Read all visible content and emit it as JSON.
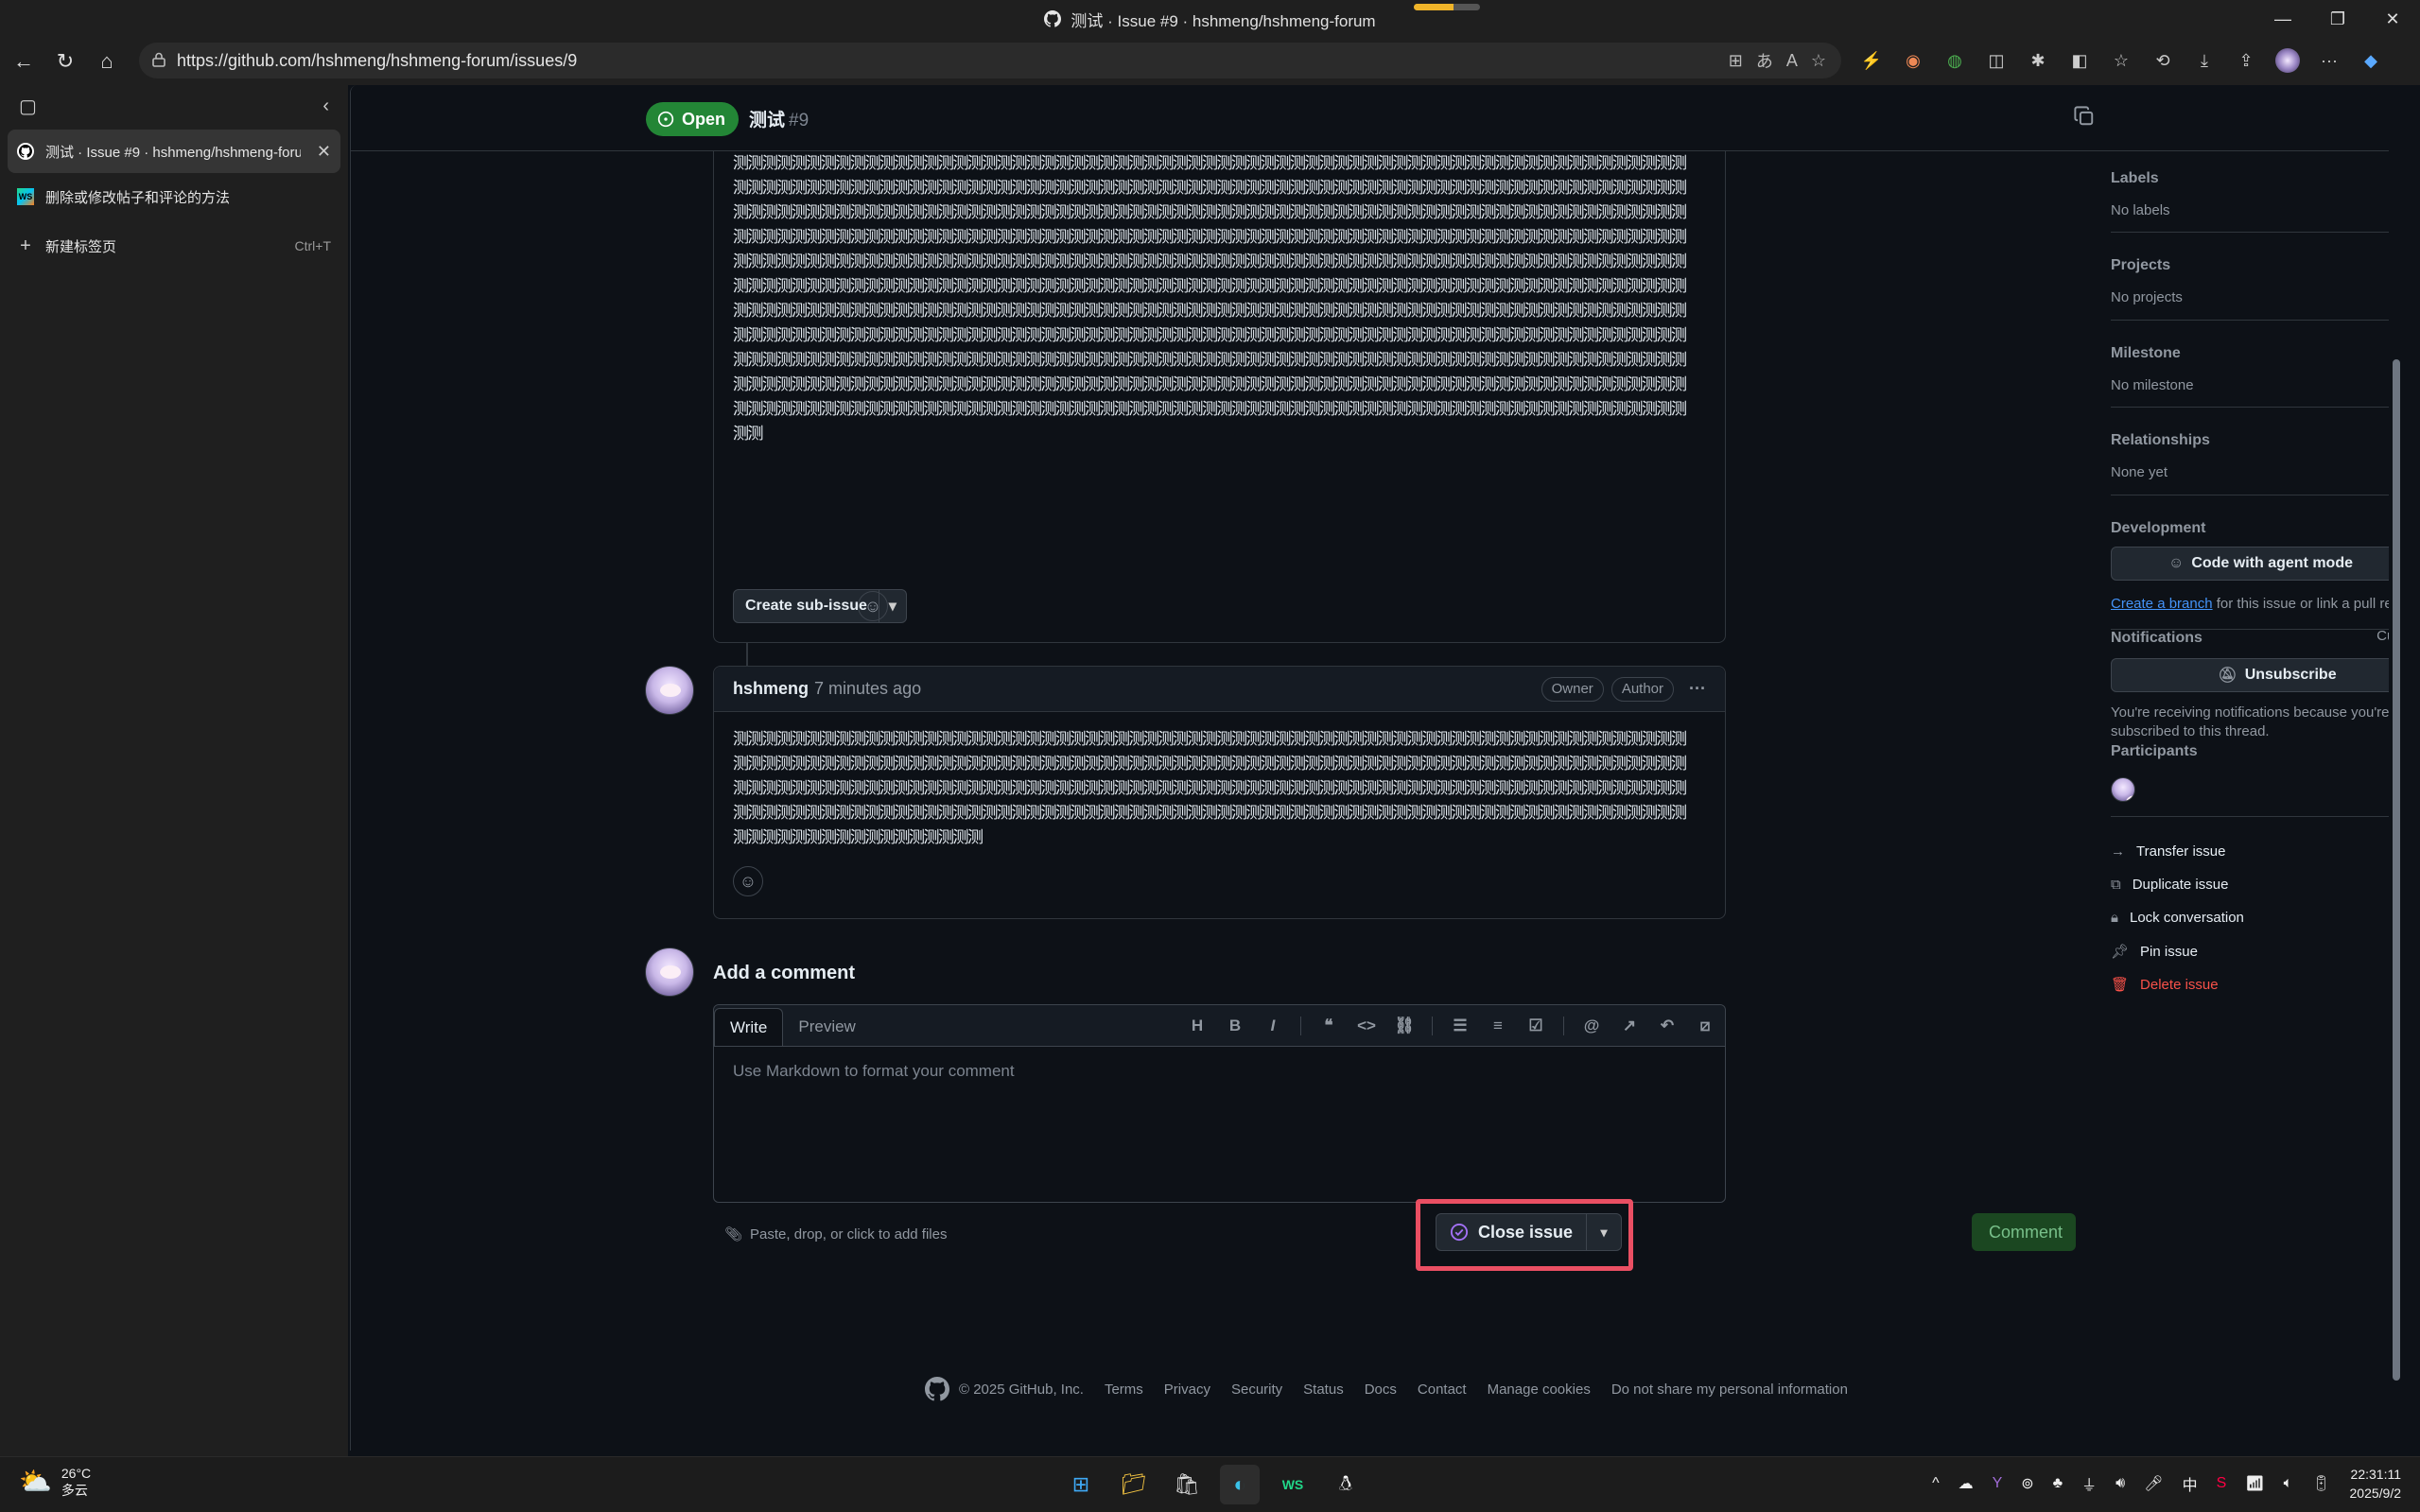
{
  "window": {
    "title": "测试 · Issue #9 · hshmeng/hshmeng-forum",
    "download_progress": 0.6,
    "controls": [
      "—",
      "❐",
      "✕"
    ]
  },
  "addressbar": {
    "url": "https://github.com/hshmeng/hshmeng-forum/issues/9"
  },
  "sidebar": {
    "tabs": [
      {
        "label": "测试 · Issue #9 · hshmeng/hshmeng-forum",
        "favicon": "github-icon",
        "active": true
      },
      {
        "label": "删除或修改帖子和评论的方法",
        "favicon": "webstorm-icon",
        "active": false
      }
    ],
    "new_tab_label": "新建标签页",
    "new_tab_shortcut": "Ctrl+T"
  },
  "issue": {
    "state_label": "Open",
    "title": "测试",
    "number": "#9",
    "body_text": "测测测测测测测测测测测测测测测测测测测测测测测测测测测测测测测测测测测测测测测测测测测测测测测测测测测测测测测测测测测测测测测测测测测测测测测测测测测测测测测测测测测测测测测测测测测测测测测测测测测测测测测测测测测测测测测测测测测测测测测测测测测测测测测测测测测测测测测测测测测测测测测测测测测测测测测测测测测测测测测测测测测测测测测测测测测测测测测测测测测测测测测测测测测测测测测测测测测测测测测测测测测测测测测测测测测测测测测测测测测测测测测测测测测测测测测测测测测测测测测测测测测测测测测测测测测测测测测测测测测测测测测测测测测测测测测测测测测测测测测测测测测测测测测测测测测测测测测测测测测测测测测测测测测测测测测测测测测测测测测测测测测测测测测测测测测测测测测测测测测测测测测测测测测测测测测测测测测测测测测测测测测测测测测测测测测测测测测测测测测测测测测测测测测测测测测测测测测测测测测测测测测测测测测测测测测测测测测测测测测测测测测测测测测测测测测测测测测测测测测测测测测测测测测测测测测测测测测测测测测测测测测测测测测测测测测测测测测测测测测测测测测测测测测测测测测测测测测测测测测测测测测测测测测测测测测测测测测测测测测测测测测测测测测测测测测测测测测测测测测测测测测测测测测测测测测测测测测测测测测测测测测测测测测测测测测测测测测测测测测测测测测测测测测测测测测测测测测测测测测测测测测测测测测测测测测测测测测测测测测测测测测测测测测测测测测测测测测测测测测测测测测测测测测测测测测测测测测测测测测测测测测测测测测测测测测测测测测测测测测测测测测测测测测测测测测测测测测测测测测测测测测测测测测测测测测测测测测测测",
    "create_sub_issue_label": "Create sub-issue"
  },
  "comment": {
    "author": "hshmeng",
    "time": "7 minutes ago",
    "badges": [
      "Owner",
      "Author"
    ],
    "more_label": "···",
    "body_text": "测测测测测测测测测测测测测测测测测测测测测测测测测测测测测测测测测测测测测测测测测测测测测测测测测测测测测测测测测测测测测测测测测测测测测测测测测测测测测测测测测测测测测测测测测测测测测测测测测测测测测测测测测测测测测测测测测测测测测测测测测测测测测测测测测测测测测测测测测测测测测测测测测测测测测测测测测测测测测测测测测测测测测测测测测测测测测测测测测测测测测测测测测测测测测测测测测测测测测测测测测测测测测测测测测测测测测测测测测测测测测测测测测测测测测测测测测测测测测测测测测测测测测测测测测测测测测测测测测测测测测测测测测测测测测测测测测测测测测"
  },
  "new_comment": {
    "heading": "Add a comment",
    "tabs": [
      "Write",
      "Preview"
    ],
    "placeholder": "Use Markdown to format your comment",
    "attach_label": "Paste, drop, or click to add files",
    "close_label": "Close issue",
    "comment_label": "Comment"
  },
  "toolbar_icons": [
    "heading-icon",
    "bold-icon",
    "italic-icon",
    "quote-icon",
    "code-icon",
    "link-icon",
    "unordered-list-icon",
    "ordered-list-icon",
    "task-list-icon",
    "mention-icon",
    "reference-icon",
    "reply-icon",
    "slash-commands-icon"
  ],
  "side": {
    "labels": {
      "title": "Labels",
      "value": "No labels"
    },
    "projects": {
      "title": "Projects",
      "value": "No projects"
    },
    "milestone": {
      "title": "Milestone",
      "value": "No milestone"
    },
    "relationships": {
      "title": "Relationships",
      "value": "None yet"
    },
    "development": {
      "title": "Development",
      "agent_label": "Code with agent mode",
      "branch_link": "Create a branch",
      "branch_suffix": " for this issue or link a pull request."
    },
    "notifications": {
      "title": "Notifications",
      "customize": "Customize",
      "unsubscribe": "Unsubscribe",
      "note": "You're receiving notifications because you're subscribed to this thread."
    },
    "participants": {
      "title": "Participants"
    },
    "actions": [
      {
        "label": "Transfer issue",
        "icon": "arrow-right-icon"
      },
      {
        "label": "Duplicate issue",
        "icon": "duplicate-icon"
      },
      {
        "label": "Lock conversation",
        "icon": "lock-icon"
      },
      {
        "label": "Pin issue",
        "icon": "pin-icon"
      },
      {
        "label": "Delete issue",
        "icon": "trash-icon"
      }
    ]
  },
  "footer": {
    "copyright": "© 2025 GitHub, Inc.",
    "links": [
      "Terms",
      "Privacy",
      "Security",
      "Status",
      "Docs",
      "Contact",
      "Manage cookies",
      "Do not share my personal information"
    ]
  },
  "taskbar": {
    "temperature": "26°C",
    "condition": "多云",
    "input_method": "中",
    "time": "22:31:11",
    "date": "2025/9/2"
  },
  "colors": {
    "open_green": "#238636",
    "highlight_red": "#ea4f63",
    "link_blue": "#4493f8",
    "danger": "#f85149"
  }
}
